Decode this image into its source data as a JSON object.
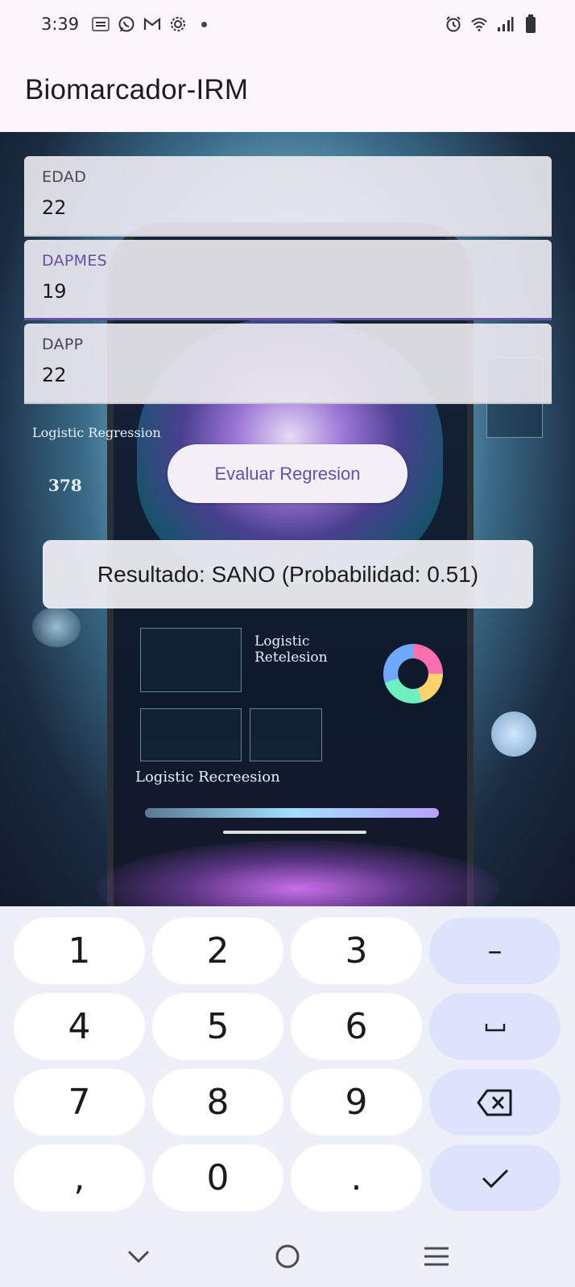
{
  "status_bar": {
    "time": "3:39",
    "left_icons": [
      "temu-icon",
      "whatsapp-icon",
      "gmail-icon",
      "settings-gear-icon",
      "dot-icon"
    ],
    "right_icons": [
      "alarm-icon",
      "wifi-icon",
      "signal-icon",
      "battery-icon"
    ]
  },
  "app_bar": {
    "title": "Biomarcador-IRM"
  },
  "form": {
    "fields": [
      {
        "label": "EDAD",
        "value": "22",
        "focused": false
      },
      {
        "label": "DAPMES",
        "value": "19",
        "focused": true
      },
      {
        "label": "DAPP",
        "value": "22",
        "focused": false
      }
    ],
    "evaluate_button": "Evaluar Regresion",
    "result": "Resultado: SANO (Probabilidad: 0.51)"
  },
  "background": {
    "texts": [
      "Logistic Regression",
      "378",
      "Logistic Retelesion",
      "Logistic Recreesion"
    ]
  },
  "keyboard": {
    "keys": [
      "1",
      "2",
      "3",
      "–",
      "4",
      "5",
      "6",
      "␣",
      "7",
      "8",
      "9",
      "⌫",
      ",",
      "0",
      ".",
      "✓"
    ],
    "action_color": "#dde3fb"
  },
  "nav_bar": {
    "buttons": [
      "back-chevron-icon",
      "home-circle-icon",
      "recents-menu-icon"
    ]
  }
}
